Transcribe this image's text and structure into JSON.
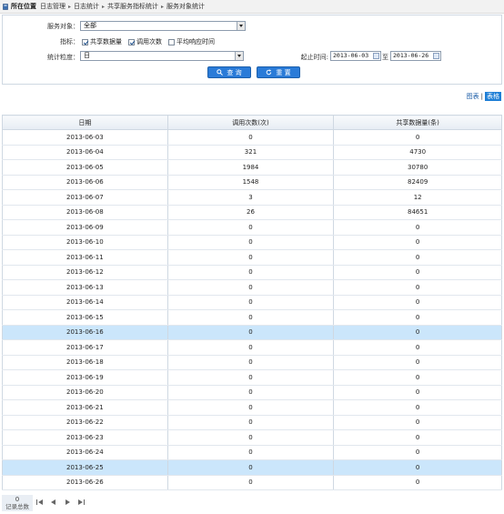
{
  "breadcrumb": {
    "current_label": "所在位置",
    "items": [
      "日志管理",
      "日志统计",
      "共享服务指标统计",
      "服务对象统计"
    ]
  },
  "filters": {
    "service_object": {
      "label": "服务对象：",
      "value": "全部"
    },
    "metrics": {
      "label": "指标：",
      "options": [
        {
          "label": "共享数据量",
          "checked": true
        },
        {
          "label": "调用次数",
          "checked": true
        },
        {
          "label": "平均响应时间",
          "checked": false
        }
      ]
    },
    "granularity": {
      "label": "统计粒度：",
      "value": "日"
    },
    "date_range": {
      "label": "起止时间:",
      "start": "2013-06-03",
      "separator": "至",
      "end": "2013-06-26"
    },
    "query_label": "查 询",
    "reset_label": "重 置"
  },
  "view_toggle": {
    "chart_label": "图表",
    "separator": "|",
    "table_label": "表格"
  },
  "table": {
    "columns": [
      "日期",
      "调用次数(次)",
      "共享数据量(条)"
    ],
    "rows": [
      {
        "date": "2013-06-03",
        "calls": "0",
        "data": "0",
        "highlight": false
      },
      {
        "date": "2013-06-04",
        "calls": "321",
        "data": "4730",
        "highlight": false
      },
      {
        "date": "2013-06-05",
        "calls": "1984",
        "data": "30780",
        "highlight": false
      },
      {
        "date": "2013-06-06",
        "calls": "1548",
        "data": "82409",
        "highlight": false
      },
      {
        "date": "2013-06-07",
        "calls": "3",
        "data": "12",
        "highlight": false
      },
      {
        "date": "2013-06-08",
        "calls": "26",
        "data": "84651",
        "highlight": false
      },
      {
        "date": "2013-06-09",
        "calls": "0",
        "data": "0",
        "highlight": false
      },
      {
        "date": "2013-06-10",
        "calls": "0",
        "data": "0",
        "highlight": false
      },
      {
        "date": "2013-06-11",
        "calls": "0",
        "data": "0",
        "highlight": false
      },
      {
        "date": "2013-06-12",
        "calls": "0",
        "data": "0",
        "highlight": false
      },
      {
        "date": "2013-06-13",
        "calls": "0",
        "data": "0",
        "highlight": false
      },
      {
        "date": "2013-06-14",
        "calls": "0",
        "data": "0",
        "highlight": false
      },
      {
        "date": "2013-06-15",
        "calls": "0",
        "data": "0",
        "highlight": false
      },
      {
        "date": "2013-06-16",
        "calls": "0",
        "data": "0",
        "highlight": true
      },
      {
        "date": "2013-06-17",
        "calls": "0",
        "data": "0",
        "highlight": false
      },
      {
        "date": "2013-06-18",
        "calls": "0",
        "data": "0",
        "highlight": false
      },
      {
        "date": "2013-06-19",
        "calls": "0",
        "data": "0",
        "highlight": false
      },
      {
        "date": "2013-06-20",
        "calls": "0",
        "data": "0",
        "highlight": false
      },
      {
        "date": "2013-06-21",
        "calls": "0",
        "data": "0",
        "highlight": false
      },
      {
        "date": "2013-06-22",
        "calls": "0",
        "data": "0",
        "highlight": false
      },
      {
        "date": "2013-06-23",
        "calls": "0",
        "data": "0",
        "highlight": false
      },
      {
        "date": "2013-06-24",
        "calls": "0",
        "data": "0",
        "highlight": false
      },
      {
        "date": "2013-06-25",
        "calls": "0",
        "data": "0",
        "highlight": true
      },
      {
        "date": "2013-06-26",
        "calls": "0",
        "data": "0",
        "highlight": false
      }
    ]
  },
  "pager": {
    "record_count": "0",
    "record_label": "记录总数"
  },
  "colors": {
    "accent": "#2a7bd8",
    "row_highlight": "#cbe6fb",
    "border": "#cfd8e2"
  },
  "icons": [
    "location-pin-icon",
    "search-icon",
    "reset-icon",
    "calendar-icon",
    "first-page-icon",
    "prev-page-icon",
    "next-page-icon",
    "last-page-icon"
  ]
}
